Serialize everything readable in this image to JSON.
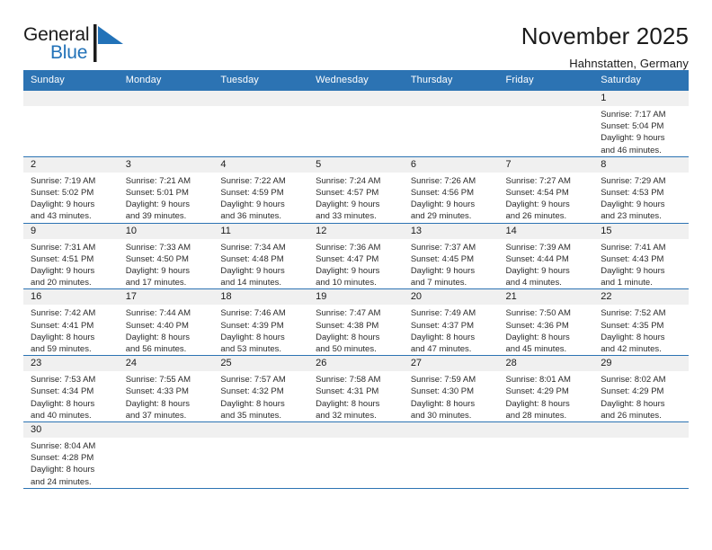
{
  "brand": {
    "name_part1": "General",
    "name_part2": "Blue",
    "flag_color": "#2272b8"
  },
  "header": {
    "title": "November 2025",
    "subtitle": "Hahnstatten, Germany"
  },
  "theme": {
    "header_blue": "#2c73b3",
    "daynum_band": "#f0f0f0",
    "cell_background": "#ffffff",
    "text": "#1b1b1b"
  },
  "weekday_headers": [
    "Sunday",
    "Monday",
    "Tuesday",
    "Wednesday",
    "Thursday",
    "Friday",
    "Saturday"
  ],
  "weeks": [
    [
      {
        "day": "",
        "empty": true
      },
      {
        "day": "",
        "empty": true
      },
      {
        "day": "",
        "empty": true
      },
      {
        "day": "",
        "empty": true
      },
      {
        "day": "",
        "empty": true
      },
      {
        "day": "",
        "empty": true
      },
      {
        "day": "1",
        "sunrise": "Sunrise: 7:17 AM",
        "sunset": "Sunset: 5:04 PM",
        "daylight_line1": "Daylight: 9 hours",
        "daylight_line2": "and 46 minutes."
      }
    ],
    [
      {
        "day": "2",
        "sunrise": "Sunrise: 7:19 AM",
        "sunset": "Sunset: 5:02 PM",
        "daylight_line1": "Daylight: 9 hours",
        "daylight_line2": "and 43 minutes."
      },
      {
        "day": "3",
        "sunrise": "Sunrise: 7:21 AM",
        "sunset": "Sunset: 5:01 PM",
        "daylight_line1": "Daylight: 9 hours",
        "daylight_line2": "and 39 minutes."
      },
      {
        "day": "4",
        "sunrise": "Sunrise: 7:22 AM",
        "sunset": "Sunset: 4:59 PM",
        "daylight_line1": "Daylight: 9 hours",
        "daylight_line2": "and 36 minutes."
      },
      {
        "day": "5",
        "sunrise": "Sunrise: 7:24 AM",
        "sunset": "Sunset: 4:57 PM",
        "daylight_line1": "Daylight: 9 hours",
        "daylight_line2": "and 33 minutes."
      },
      {
        "day": "6",
        "sunrise": "Sunrise: 7:26 AM",
        "sunset": "Sunset: 4:56 PM",
        "daylight_line1": "Daylight: 9 hours",
        "daylight_line2": "and 29 minutes."
      },
      {
        "day": "7",
        "sunrise": "Sunrise: 7:27 AM",
        "sunset": "Sunset: 4:54 PM",
        "daylight_line1": "Daylight: 9 hours",
        "daylight_line2": "and 26 minutes."
      },
      {
        "day": "8",
        "sunrise": "Sunrise: 7:29 AM",
        "sunset": "Sunset: 4:53 PM",
        "daylight_line1": "Daylight: 9 hours",
        "daylight_line2": "and 23 minutes."
      }
    ],
    [
      {
        "day": "9",
        "sunrise": "Sunrise: 7:31 AM",
        "sunset": "Sunset: 4:51 PM",
        "daylight_line1": "Daylight: 9 hours",
        "daylight_line2": "and 20 minutes."
      },
      {
        "day": "10",
        "sunrise": "Sunrise: 7:33 AM",
        "sunset": "Sunset: 4:50 PM",
        "daylight_line1": "Daylight: 9 hours",
        "daylight_line2": "and 17 minutes."
      },
      {
        "day": "11",
        "sunrise": "Sunrise: 7:34 AM",
        "sunset": "Sunset: 4:48 PM",
        "daylight_line1": "Daylight: 9 hours",
        "daylight_line2": "and 14 minutes."
      },
      {
        "day": "12",
        "sunrise": "Sunrise: 7:36 AM",
        "sunset": "Sunset: 4:47 PM",
        "daylight_line1": "Daylight: 9 hours",
        "daylight_line2": "and 10 minutes."
      },
      {
        "day": "13",
        "sunrise": "Sunrise: 7:37 AM",
        "sunset": "Sunset: 4:45 PM",
        "daylight_line1": "Daylight: 9 hours",
        "daylight_line2": "and 7 minutes."
      },
      {
        "day": "14",
        "sunrise": "Sunrise: 7:39 AM",
        "sunset": "Sunset: 4:44 PM",
        "daylight_line1": "Daylight: 9 hours",
        "daylight_line2": "and 4 minutes."
      },
      {
        "day": "15",
        "sunrise": "Sunrise: 7:41 AM",
        "sunset": "Sunset: 4:43 PM",
        "daylight_line1": "Daylight: 9 hours",
        "daylight_line2": "and 1 minute."
      }
    ],
    [
      {
        "day": "16",
        "sunrise": "Sunrise: 7:42 AM",
        "sunset": "Sunset: 4:41 PM",
        "daylight_line1": "Daylight: 8 hours",
        "daylight_line2": "and 59 minutes."
      },
      {
        "day": "17",
        "sunrise": "Sunrise: 7:44 AM",
        "sunset": "Sunset: 4:40 PM",
        "daylight_line1": "Daylight: 8 hours",
        "daylight_line2": "and 56 minutes."
      },
      {
        "day": "18",
        "sunrise": "Sunrise: 7:46 AM",
        "sunset": "Sunset: 4:39 PM",
        "daylight_line1": "Daylight: 8 hours",
        "daylight_line2": "and 53 minutes."
      },
      {
        "day": "19",
        "sunrise": "Sunrise: 7:47 AM",
        "sunset": "Sunset: 4:38 PM",
        "daylight_line1": "Daylight: 8 hours",
        "daylight_line2": "and 50 minutes."
      },
      {
        "day": "20",
        "sunrise": "Sunrise: 7:49 AM",
        "sunset": "Sunset: 4:37 PM",
        "daylight_line1": "Daylight: 8 hours",
        "daylight_line2": "and 47 minutes."
      },
      {
        "day": "21",
        "sunrise": "Sunrise: 7:50 AM",
        "sunset": "Sunset: 4:36 PM",
        "daylight_line1": "Daylight: 8 hours",
        "daylight_line2": "and 45 minutes."
      },
      {
        "day": "22",
        "sunrise": "Sunrise: 7:52 AM",
        "sunset": "Sunset: 4:35 PM",
        "daylight_line1": "Daylight: 8 hours",
        "daylight_line2": "and 42 minutes."
      }
    ],
    [
      {
        "day": "23",
        "sunrise": "Sunrise: 7:53 AM",
        "sunset": "Sunset: 4:34 PM",
        "daylight_line1": "Daylight: 8 hours",
        "daylight_line2": "and 40 minutes."
      },
      {
        "day": "24",
        "sunrise": "Sunrise: 7:55 AM",
        "sunset": "Sunset: 4:33 PM",
        "daylight_line1": "Daylight: 8 hours",
        "daylight_line2": "and 37 minutes."
      },
      {
        "day": "25",
        "sunrise": "Sunrise: 7:57 AM",
        "sunset": "Sunset: 4:32 PM",
        "daylight_line1": "Daylight: 8 hours",
        "daylight_line2": "and 35 minutes."
      },
      {
        "day": "26",
        "sunrise": "Sunrise: 7:58 AM",
        "sunset": "Sunset: 4:31 PM",
        "daylight_line1": "Daylight: 8 hours",
        "daylight_line2": "and 32 minutes."
      },
      {
        "day": "27",
        "sunrise": "Sunrise: 7:59 AM",
        "sunset": "Sunset: 4:30 PM",
        "daylight_line1": "Daylight: 8 hours",
        "daylight_line2": "and 30 minutes."
      },
      {
        "day": "28",
        "sunrise": "Sunrise: 8:01 AM",
        "sunset": "Sunset: 4:29 PM",
        "daylight_line1": "Daylight: 8 hours",
        "daylight_line2": "and 28 minutes."
      },
      {
        "day": "29",
        "sunrise": "Sunrise: 8:02 AM",
        "sunset": "Sunset: 4:29 PM",
        "daylight_line1": "Daylight: 8 hours",
        "daylight_line2": "and 26 minutes."
      }
    ],
    [
      {
        "day": "30",
        "sunrise": "Sunrise: 8:04 AM",
        "sunset": "Sunset: 4:28 PM",
        "daylight_line1": "Daylight: 8 hours",
        "daylight_line2": "and 24 minutes."
      },
      {
        "day": "",
        "empty": true
      },
      {
        "day": "",
        "empty": true
      },
      {
        "day": "",
        "empty": true
      },
      {
        "day": "",
        "empty": true
      },
      {
        "day": "",
        "empty": true
      },
      {
        "day": "",
        "empty": true
      }
    ]
  ]
}
